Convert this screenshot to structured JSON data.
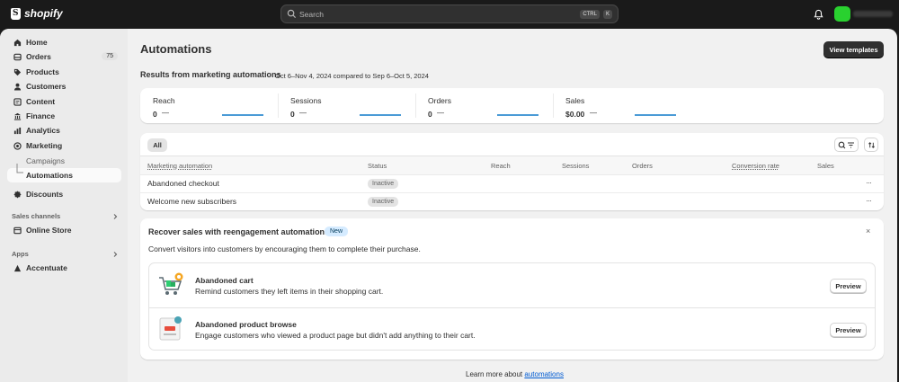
{
  "topbar": {
    "brand": "shopify",
    "search_placeholder": "Search",
    "kbd": [
      "CTRL",
      "K"
    ]
  },
  "sidebar": {
    "items": [
      {
        "label": "Home",
        "icon": "home-icon"
      },
      {
        "label": "Orders",
        "icon": "orders-icon",
        "badge": "75"
      },
      {
        "label": "Products",
        "icon": "tag-icon"
      },
      {
        "label": "Customers",
        "icon": "person-icon"
      },
      {
        "label": "Content",
        "icon": "content-icon"
      },
      {
        "label": "Finance",
        "icon": "bank-icon"
      },
      {
        "label": "Analytics",
        "icon": "chart-icon"
      },
      {
        "label": "Marketing",
        "icon": "target-icon"
      }
    ],
    "marketing_sub": [
      "Campaigns",
      "Automations"
    ],
    "discounts": "Discounts",
    "sales_channels_title": "Sales channels",
    "online_store": "Online Store",
    "apps_title": "Apps",
    "app_item": "Accentuate"
  },
  "page": {
    "title": "Automations",
    "view_templates": "View templates",
    "results_title": "Results from marketing automations",
    "results_range": "Oct 6–Nov 4, 2024 compared to Sep 6–Oct 5, 2024"
  },
  "metrics": [
    {
      "label": "Reach",
      "value": "0",
      "change": "—"
    },
    {
      "label": "Sessions",
      "value": "0",
      "change": "—"
    },
    {
      "label": "Orders",
      "value": "0",
      "change": "—"
    },
    {
      "label": "Sales",
      "value": "$0.00",
      "change": "—"
    }
  ],
  "table": {
    "tab_all": "All",
    "headers": [
      "Marketing automation",
      "Status",
      "Reach",
      "Sessions",
      "Orders",
      "Conversion rate",
      "Sales"
    ],
    "rows": [
      {
        "name": "Abandoned checkout",
        "status": "Inactive"
      },
      {
        "name": "Welcome new subscribers",
        "status": "Inactive"
      }
    ],
    "more": "···"
  },
  "reengagement": {
    "title": "Recover sales with reengagement automations",
    "badge": "New",
    "close": "×",
    "subtitle": "Convert visitors into customers by encouraging them to complete their purchase.",
    "items": [
      {
        "title": "Abandoned cart",
        "desc": "Remind customers they left items in their shopping cart.",
        "button": "Preview"
      },
      {
        "title": "Abandoned product browse",
        "desc": "Engage customers who viewed a product page but didn't add anything to their cart.",
        "button": "Preview"
      }
    ]
  },
  "footer": {
    "learn_prefix": "Learn more about ",
    "learn_link": "automations"
  },
  "colors": {
    "topbar": "#1a1a1a",
    "accent_link": "#005bd3",
    "spark": "#4b9bd6",
    "avatar": "#29d12f"
  }
}
